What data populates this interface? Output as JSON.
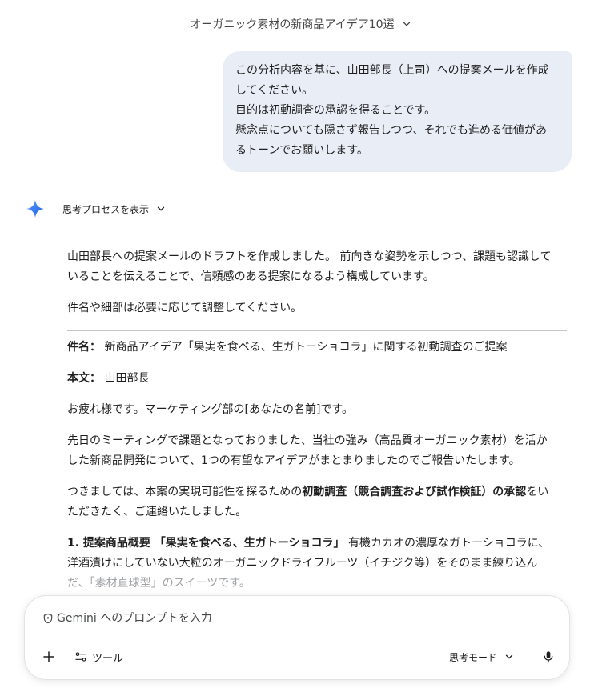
{
  "header": {
    "title": "オーガニック素材の新商品アイデア10選"
  },
  "user_message": {
    "lines": [
      "この分析内容を基に、山田部長（上司）への提案メールを作成",
      "してください。",
      "目的は初動調査の承認を得ることです。",
      "懸念点についても隠さず報告しつつ、それでも進める価値があ",
      "るトーンでお願いします。"
    ]
  },
  "thinking": {
    "label": "思考プロセスを表示"
  },
  "response": {
    "intro_lines": [
      "山田部長への提案メールのドラフトを作成しました。 前向きな姿勢を示しつつ、課題も認識して",
      "いることを伝えることで、信頼感のある提案になるよう構成しています。"
    ],
    "note": "件名や細部は必要に応じて調整してください。",
    "subject_label": "件名：",
    "subject_text": " 新商品アイデア「果実を食べる、生ガトーショコラ」に関する初動調査のご提案",
    "body_label": "本文：",
    "body_text": " 山田部長",
    "greeting": "お疲れ様です。マーケティング部の[あなたの名前]です。",
    "para1_lines": [
      "先日のミーティングで課題となっておりました、当社の強み（高品質オーガニック素材）を活か",
      "した新商品開発について、1つの有望なアイデアがまとまりましたのでご報告いたします。"
    ],
    "para2_line1_a": "つきましては、本案の実現可能性を探るための",
    "para2_line1_b": "初動調査（競合調査および試作検証）の承認",
    "para2_line1_c": "をい",
    "para2_line2": "ただきたく、ご連絡いたしました。",
    "section1_heading": "1. 提案商品概要 「果実を食べる、生ガトーショコラ」",
    "section1_line1_rest": " 有機カカオの濃厚なガトーショコラに、",
    "section1_line2": "洋酒漬けにしていない大粒のオーガニックドライフルーツ（イチジク等）をそのまま練り込ん",
    "section1_line3": "だ、「素材直球型」のスイーツです。"
  },
  "composer": {
    "placeholder": "Gemini へのプロンプトを入力",
    "tools_label": "ツール",
    "mode_label": "思考モード"
  },
  "icons": {
    "spark": "gemini-spark-icon",
    "chevron": "chevron-down-icon",
    "shield": "shield-icon",
    "plus": "plus-icon",
    "tools": "tools-sliders-icon",
    "mic": "microphone-icon"
  },
  "colors": {
    "user_bubble": "#e9eef6",
    "spark_gradient_start": "#4a8df8",
    "spark_gradient_end": "#1a5ee8",
    "text": "#1f1f1f",
    "muted": "#444746"
  }
}
